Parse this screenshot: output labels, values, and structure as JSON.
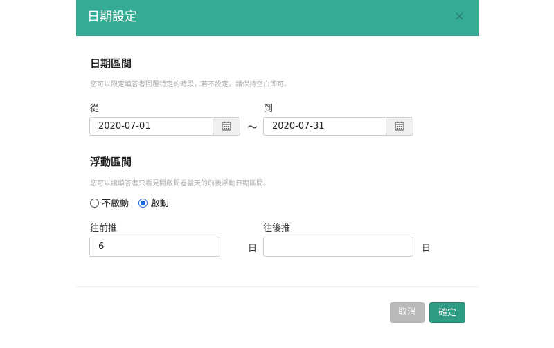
{
  "dialog": {
    "title": "日期設定",
    "close_glyph": "×"
  },
  "date_range": {
    "title": "日期區間",
    "hint": "您可以限定填答者回覆特定的時段，若不設定，請保持空白即可。",
    "from_label": "從",
    "from_value": "2020-07-01",
    "separator": "～",
    "to_label": "到",
    "to_value": "2020-07-31",
    "calendar_icon": "calendar-icon"
  },
  "floating_range": {
    "title": "浮動區間",
    "hint": "您可以讓填答者只看見開啟問卷當天的前後浮動日期區間。",
    "options": [
      "不啟動",
      "啟動"
    ],
    "selected": "啟動",
    "forward_label": "往前推",
    "forward_value": "6",
    "backward_label": "往後推",
    "backward_value": "",
    "unit": "日"
  },
  "footer": {
    "cancel_label": "取消",
    "ok_label": "確定"
  },
  "colors": {
    "header": "#35ab94",
    "primary_button": "#2f9d85",
    "cancel_button": "#b9b9b9"
  }
}
